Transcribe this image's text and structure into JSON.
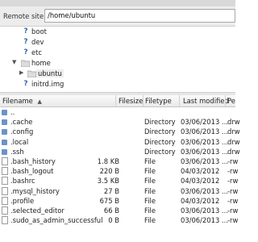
{
  "remote": {
    "label": "Remote site:",
    "path": "/home/ubuntu"
  },
  "tree": [
    {
      "name": "boot",
      "icon": "unknown-folder-icon"
    },
    {
      "name": "dev",
      "icon": "unknown-folder-icon"
    },
    {
      "name": "etc",
      "icon": "unknown-folder-icon"
    },
    {
      "name": "home",
      "icon": "folder-icon",
      "expanded": true
    },
    {
      "name": "ubuntu",
      "icon": "folder-icon",
      "selected": true
    },
    {
      "name": "initrd.img",
      "icon": "unknown-folder-icon"
    }
  ],
  "columns": {
    "name": "Filename",
    "sort_indicator": "▲",
    "size": "Filesize",
    "type": "Filetype",
    "modified": "Last modified",
    "perm": "Pe"
  },
  "files": [
    {
      "name": "..",
      "size": "",
      "type": "",
      "modified": "",
      "perm": "",
      "kind": "folder"
    },
    {
      "name": ".cache",
      "size": "",
      "type": "Directory",
      "modified": "03/06/2013 ...",
      "perm": "drw",
      "kind": "folder"
    },
    {
      "name": ".config",
      "size": "",
      "type": "Directory",
      "modified": "03/06/2013 ...",
      "perm": "drw",
      "kind": "folder"
    },
    {
      "name": ".local",
      "size": "",
      "type": "Directory",
      "modified": "03/06/2013 ...",
      "perm": "drw",
      "kind": "folder"
    },
    {
      "name": ".ssh",
      "size": "",
      "type": "Directory",
      "modified": "03/06/2013 ...",
      "perm": "drw",
      "kind": "folder"
    },
    {
      "name": ".bash_history",
      "size": "1.8 KB",
      "type": "File",
      "modified": "03/06/2013 ...",
      "perm": "-rw",
      "kind": "file"
    },
    {
      "name": ".bash_logout",
      "size": "220 B",
      "type": "File",
      "modified": "04/03/2012",
      "perm": "-rw",
      "kind": "file"
    },
    {
      "name": ".bashrc",
      "size": "3.5 KB",
      "type": "File",
      "modified": "04/03/2012",
      "perm": "-rw",
      "kind": "file"
    },
    {
      "name": ".mysql_history",
      "size": "27 B",
      "type": "File",
      "modified": "03/06/2013 ...",
      "perm": "-rw",
      "kind": "file"
    },
    {
      "name": ".profile",
      "size": "675 B",
      "type": "File",
      "modified": "04/03/2012",
      "perm": "-rw",
      "kind": "file"
    },
    {
      "name": ".selected_editor",
      "size": "66 B",
      "type": "File",
      "modified": "03/06/2013 ...",
      "perm": "-rw",
      "kind": "file"
    },
    {
      "name": ".sudo_as_admin_successful",
      "size": "0 B",
      "type": "File",
      "modified": "03/06/2013 ...",
      "perm": "-rw",
      "kind": "file"
    }
  ]
}
